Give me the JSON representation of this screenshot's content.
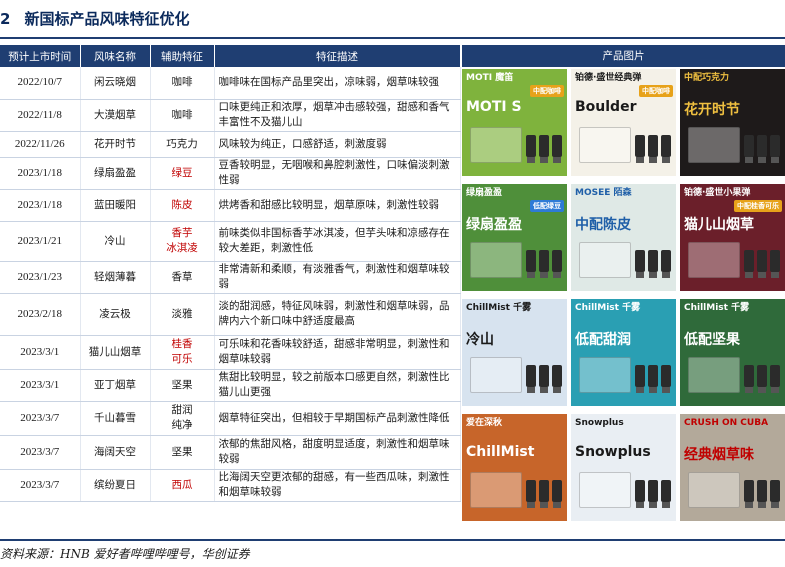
{
  "title": {
    "number": "2",
    "text": "新国标产品风味特征优化"
  },
  "table": {
    "headers": [
      "预计上市时间",
      "风味名称",
      "辅助特征",
      "特征描述"
    ],
    "rows": [
      {
        "date": "2022/10/7",
        "name": "闲云晓烟",
        "aux": "咖啡",
        "aux_red": false,
        "desc": "咖啡味在国标产品里突出，凉味弱，烟草味较强"
      },
      {
        "date": "2022/11/8",
        "name": "大漠烟草",
        "aux": "咖啡",
        "aux_red": false,
        "desc": "口味更纯正和浓厚，烟草冲击感较强，甜感和香气丰富性不及猫儿山"
      },
      {
        "date": "2022/11/26",
        "name": "花开时节",
        "aux": "巧克力",
        "aux_red": false,
        "desc": "风味较为纯正，口感舒适，刺激度弱"
      },
      {
        "date": "2023/1/18",
        "name": "绿扇盈盈",
        "aux": "绿豆",
        "aux_red": true,
        "desc": "豆香较明显，无咽喉和鼻腔刺激性，口味偏淡刺激性弱"
      },
      {
        "date": "2023/1/18",
        "name": "蓝田暖阳",
        "aux": "陈皮",
        "aux_red": true,
        "desc": "烘烤香和甜感比较明显，烟草原味，刺激性较弱"
      },
      {
        "date": "2023/1/21",
        "name": "冷山",
        "aux": "香芋\n冰淇凌",
        "aux_red": true,
        "desc": "前味类似非国标香芋冰淇凌，但芋头味和凉感存在较大差距，刺激性低"
      },
      {
        "date": "2023/1/23",
        "name": "轻烟薄暮",
        "aux": "香草",
        "aux_red": false,
        "desc": "非常清新和柔顺，有淡雅香气，刺激性和烟草味较弱"
      },
      {
        "date": "2023/2/18",
        "name": "凌云极",
        "aux": "淡雅",
        "aux_red": false,
        "desc": "淡的甜润感，特征风味弱，刺激性和烟草味弱，品牌内六个新口味中舒适度最高"
      },
      {
        "date": "2023/3/1",
        "name": "猫儿山烟草",
        "aux": "桂香\n可乐",
        "aux_red": true,
        "desc": "可乐味和花香味较舒适，甜感非常明显，刺激性和烟草味较弱"
      },
      {
        "date": "2023/3/1",
        "name": "亚丁烟草",
        "aux": "坚果",
        "aux_red": false,
        "desc": "焦甜比较明显，较之前版本口感更自然，刺激性比猫儿山更强"
      },
      {
        "date": "2023/3/7",
        "name": "千山暮雪",
        "aux": "甜润\n纯净",
        "aux_red": false,
        "desc": "烟草特征突出，但相较于早期国标产品刺激性降低"
      },
      {
        "date": "2023/3/7",
        "name": "海阔天空",
        "aux": "坚果",
        "aux_red": false,
        "desc": "浓郁的焦甜风格，甜度明显适度，刺激性和烟草味较弱"
      },
      {
        "date": "2023/3/7",
        "name": "缤纷夏日",
        "aux": "西瓜",
        "aux_red": true,
        "desc": "比海阔天空更浓郁的甜感，有一些西瓜味，刺激性和烟草味较弱"
      }
    ]
  },
  "images": {
    "header": "产品图片",
    "tiles": [
      {
        "label": "MOTI 魔笛",
        "big": "MOTI S",
        "tag": "中配咖啡",
        "bg": "#7fb33d",
        "fg": "#ffffff",
        "tagbg": "#e7a21a"
      },
      {
        "label": "铂德·盛世经典弹",
        "big": "Boulder",
        "tag": "中配咖啡",
        "bg": "#f4f1e8",
        "fg": "#1a1a1a",
        "tagbg": "#e7a21a"
      },
      {
        "label": "中配巧克力",
        "big": "花开时节",
        "tag": "",
        "bg": "#1e1a1a",
        "fg": "#f0c040",
        "tagbg": "#d23a2a"
      },
      {
        "label": "绿扇盈盈",
        "big": "绿扇盈盈",
        "tag": "低配绿豆",
        "bg": "#4f8f3a",
        "fg": "#ffffff",
        "tagbg": "#2e7bd6"
      },
      {
        "label": "MOSEE 陌森",
        "big": "中配陈皮",
        "tag": "",
        "bg": "#dfe9e6",
        "fg": "#1f5fa8",
        "tagbg": "#2e7bd6"
      },
      {
        "label": "铂德·盛世小果弹",
        "big": "猫儿山烟草",
        "tag": "中配桂香可乐",
        "bg": "#6b1f2a",
        "fg": "#ffffff",
        "tagbg": "#e7a21a"
      },
      {
        "label": "ChillMist 千雾",
        "big": "冷山",
        "tag": "",
        "bg": "#d7e3ef",
        "fg": "#1a1a1a",
        "tagbg": "#2e7bd6"
      },
      {
        "label": "ChillMist 千雾",
        "big": "低配甜润",
        "tag": "",
        "bg": "#2a9fb3",
        "fg": "#ffffff",
        "tagbg": "#2e7bd6"
      },
      {
        "label": "ChillMist 千雾",
        "big": "低配坚果",
        "tag": "",
        "bg": "#2f6a3a",
        "fg": "#ffffff",
        "tagbg": "#2e7bd6"
      },
      {
        "label": "爱在深秋",
        "big": "ChillMist",
        "tag": "",
        "bg": "#c7652a",
        "fg": "#ffffff",
        "tagbg": "#2e7bd6"
      },
      {
        "label": "Snowplus",
        "big": "Snowplus",
        "tag": "",
        "bg": "#e9eef3",
        "fg": "#1a1a1a",
        "tagbg": "#2e7bd6"
      },
      {
        "label": "CRUSH ON CUBA",
        "big": "经典烟草味",
        "tag": "",
        "bg": "#b3a99a",
        "fg": "#c00000",
        "tagbg": "#2e7bd6"
      }
    ]
  },
  "source": "资料来源：HNB 爱好者哔哩哔哩号，华创证券"
}
